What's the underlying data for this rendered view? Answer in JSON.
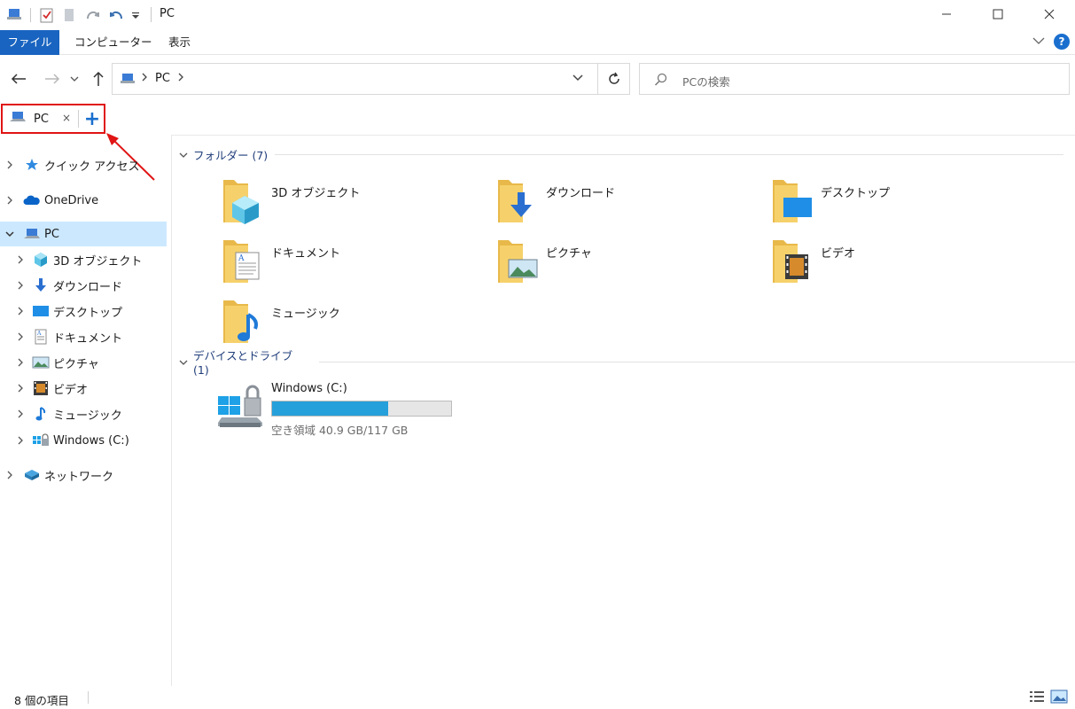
{
  "window": {
    "title": "PC"
  },
  "ribbon": {
    "tabs": [
      "ファイル",
      "コンピューター",
      "表示"
    ],
    "help": "?"
  },
  "address": {
    "crumbs": [
      "PC"
    ]
  },
  "search": {
    "placeholder": "PCの検索"
  },
  "tabs": {
    "items": [
      {
        "label": "PC",
        "close": "×"
      }
    ],
    "new_tab": "+"
  },
  "nav": {
    "items": [
      {
        "label": "クイック アクセス",
        "icon": "star-icon"
      },
      {
        "label": "OneDrive",
        "icon": "cloud-icon"
      },
      {
        "label": "PC",
        "icon": "pc-icon",
        "selected": true
      },
      {
        "label": "3D オブジェクト",
        "icon": "cube-icon"
      },
      {
        "label": "ダウンロード",
        "icon": "download-icon"
      },
      {
        "label": "デスクトップ",
        "icon": "desktop-icon"
      },
      {
        "label": "ドキュメント",
        "icon": "document-icon"
      },
      {
        "label": "ピクチャ",
        "icon": "picture-icon"
      },
      {
        "label": "ビデオ",
        "icon": "video-icon"
      },
      {
        "label": "ミュージック",
        "icon": "music-icon"
      },
      {
        "label": "Windows (C:)",
        "icon": "drive-icon"
      },
      {
        "label": "ネットワーク",
        "icon": "network-icon"
      }
    ]
  },
  "content": {
    "folders_header": "フォルダー (7)",
    "folders": [
      {
        "label": "3D オブジェクト",
        "icon": "cube-folder-icon"
      },
      {
        "label": "ダウンロード",
        "icon": "download-folder-icon"
      },
      {
        "label": "デスクトップ",
        "icon": "desktop-folder-icon"
      },
      {
        "label": "ドキュメント",
        "icon": "document-folder-icon"
      },
      {
        "label": "ピクチャ",
        "icon": "picture-folder-icon"
      },
      {
        "label": "ビデオ",
        "icon": "video-folder-icon"
      },
      {
        "label": "ミュージック",
        "icon": "music-folder-icon"
      }
    ],
    "devices_header": "デバイスとドライブ (1)",
    "drive": {
      "label": "Windows (C:)",
      "free": "空き領域 40.9 GB/117 GB",
      "used_fraction": 0.65
    }
  },
  "status": {
    "count": "8 個の項目"
  },
  "colors": {
    "accent": "#1964c0",
    "selected": "#cce8ff",
    "drive_bar": "#26a0da",
    "highlight": "#e01414"
  }
}
